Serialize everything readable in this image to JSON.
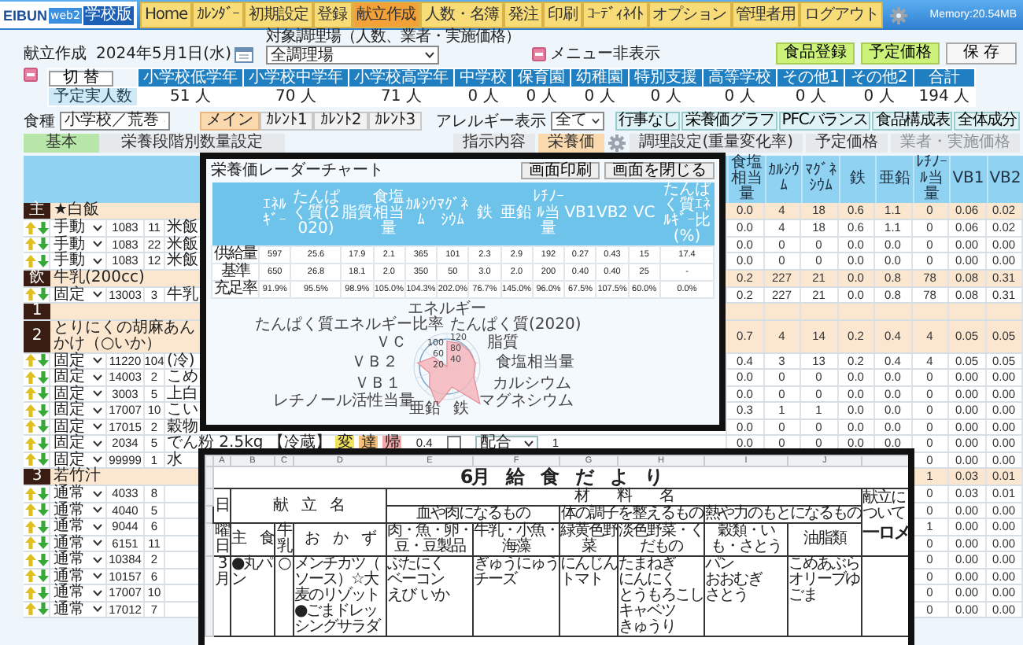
{
  "nav": {
    "logo": {
      "brand": "EIBUN",
      "product": "web2",
      "edition": "学校版"
    },
    "items": [
      {
        "label": "Home",
        "selected": false
      },
      {
        "label": "ｶﾚﾝﾀﾞｰ",
        "selected": false
      },
      {
        "label": "初期設定",
        "selected": false
      },
      {
        "label": "登録",
        "selected": false
      },
      {
        "label": "献立作成",
        "selected": true
      },
      {
        "label": "人数・名簿",
        "selected": false
      },
      {
        "label": "発注",
        "selected": false
      },
      {
        "label": "印刷",
        "selected": false
      },
      {
        "label": "ｺｰﾃﾞｨﾈｲﾄ",
        "selected": false
      },
      {
        "label": "オプション",
        "selected": false
      },
      {
        "label": "管理者用",
        "selected": false
      },
      {
        "label": "ログアウト",
        "selected": false
      }
    ],
    "memory": "Memory:20.54MB"
  },
  "header": {
    "title": "献立作成",
    "date": "2024年5月1日(水)",
    "kitchen_label": "対象調理場（人数、業者・実施価格）",
    "kitchen": "全調理場",
    "hide_menu": "メニュー非表示",
    "buttons": [
      {
        "label": "食品登録",
        "kind": "green"
      },
      {
        "label": "予定価格",
        "kind": "green"
      },
      {
        "label": "保 存",
        "kind": "plain"
      }
    ]
  },
  "headcount": {
    "switch_button": "切 替",
    "row_label": "予定実人数",
    "columns": [
      {
        "label": "小学校低学年",
        "count": "51 人"
      },
      {
        "label": "小学校中学年",
        "count": "70 人"
      },
      {
        "label": "小学校高学年",
        "count": "71 人"
      },
      {
        "label": "中学校",
        "count": "0 人"
      },
      {
        "label": "保育園",
        "count": "0 人"
      },
      {
        "label": "幼稚園",
        "count": "0 人"
      },
      {
        "label": "特別支援",
        "count": "0 人"
      },
      {
        "label": "高等学校",
        "count": "0 人"
      },
      {
        "label": "その他1",
        "count": "0 人"
      },
      {
        "label": "その他2",
        "count": "0 人"
      },
      {
        "label": "合計",
        "count": "194 人"
      }
    ]
  },
  "filters": {
    "meal_type_label": "食種",
    "meal_type": "小学校／荒巻",
    "menu_tabs": [
      {
        "label": "メイン",
        "selected": true
      },
      {
        "label": "ｶﾚﾝﾄ1",
        "selected": false
      },
      {
        "label": "ｶﾚﾝﾄ2",
        "selected": false
      },
      {
        "label": "ｶﾚﾝﾄ3",
        "selected": false
      }
    ],
    "allergy_label": "アレルギー表示",
    "allergy": "全て",
    "buttons": [
      "行事なし",
      "栄養価グラフ",
      "PFCバランス",
      "食品構成表",
      "全体成分"
    ]
  },
  "view_tabs": {
    "left": [
      {
        "label": "基本",
        "selected": true
      },
      {
        "label": "栄養段階別数量設定",
        "selected": false
      }
    ],
    "right": [
      {
        "label": "指示内容",
        "selected": false,
        "disabled": false,
        "has_gear": false
      },
      {
        "label": "栄養価",
        "selected": true,
        "disabled": false,
        "has_gear": false
      },
      {
        "label": "調理設定(重量変化率)",
        "selected": false,
        "disabled": false,
        "has_gear": true
      },
      {
        "label": "予定価格",
        "selected": false,
        "disabled": false,
        "has_gear": false
      },
      {
        "label": "業者・実施価格",
        "selected": false,
        "disabled": true,
        "has_gear": false
      }
    ]
  },
  "table": {
    "columns": [
      "食塩相当量",
      "ｶﾙｼｳﾑ",
      "ﾏｸﾞﾈｼｳﾑ",
      "鉄",
      "亜鉛",
      "ﾚﾁﾉｰﾙ当量",
      "VB1",
      "VB2"
    ],
    "rows": [
      {
        "kind": "section",
        "label": "主",
        "title": "★白飯",
        "values": [
          "0.0",
          "4",
          "18",
          "0.6",
          "1.1",
          "0",
          "0.06",
          "0.02"
        ]
      },
      {
        "kind": "item",
        "mode": "手動",
        "code": "1083",
        "qty": "11",
        "name": "米飯",
        "values": [
          "0.0",
          "4",
          "18",
          "0.6",
          "1.1",
          "0",
          "0.06",
          "0.02"
        ]
      },
      {
        "kind": "item",
        "mode": "手動",
        "code": "1083",
        "qty": "22",
        "name": "米飯",
        "values": [
          "0.0",
          "0",
          "0",
          "0.0",
          "0.0",
          "0",
          "0.00",
          "0.00"
        ]
      },
      {
        "kind": "item",
        "mode": "手動",
        "code": "1083",
        "qty": "12",
        "name": "米飯",
        "values": [
          "0.0",
          "0",
          "0",
          "0.0",
          "0.0",
          "0",
          "0.00",
          "0.00"
        ]
      },
      {
        "kind": "section",
        "label": "飲",
        "title": "牛乳(200cc)",
        "values": [
          "0.2",
          "227",
          "21",
          "0.0",
          "0.8",
          "78",
          "0.08",
          "0.31"
        ]
      },
      {
        "kind": "item",
        "mode": "固定",
        "code": "13003",
        "qty": "3",
        "name": "牛乳",
        "values": [
          "0.2",
          "227",
          "21",
          "0.0",
          "0.8",
          "78",
          "0.08",
          "0.31"
        ]
      },
      {
        "kind": "section",
        "label": "1"
      },
      {
        "kind": "section",
        "label": "2",
        "title": "とりにくの胡麻あんかけ（○いか）",
        "values": [
          "0.7",
          "4",
          "14",
          "0.2",
          "0.4",
          "4",
          "0.05",
          "0.05"
        ]
      },
      {
        "kind": "item",
        "mode": "固定",
        "code": "11220",
        "qty": "104",
        "name": "(冷)",
        "values": [
          "0.4",
          "3",
          "13",
          "0.2",
          "0.4",
          "4",
          "0.05",
          "0.05"
        ]
      },
      {
        "kind": "item",
        "mode": "固定",
        "code": "14003",
        "qty": "2",
        "name": "こめ",
        "values": [
          "0.0",
          "0",
          "0",
          "0.0",
          "0.0",
          "0",
          "0.00",
          "0.00"
        ]
      },
      {
        "kind": "item",
        "mode": "固定",
        "code": "3003",
        "qty": "5",
        "name": "上白",
        "values": [
          "0.0",
          "0",
          "0",
          "0.0",
          "0.0",
          "0",
          "0.00",
          "0.00"
        ]
      },
      {
        "kind": "item",
        "mode": "固定",
        "code": "17007",
        "qty": "10",
        "name": "こい",
        "values": [
          "0.3",
          "1",
          "1",
          "0.0",
          "0.0",
          "0",
          "0.00",
          "0.00"
        ]
      },
      {
        "kind": "item",
        "mode": "固定",
        "code": "17015",
        "qty": "2",
        "name": "穀物",
        "values": [
          "0.0",
          "0",
          "0",
          "0.0",
          "0.0",
          "0",
          "0.00",
          "0.00"
        ]
      },
      {
        "kind": "item",
        "mode": "固定",
        "code": "2034",
        "qty": "5",
        "name": "でん粉 2.5kg 【冷蔵】",
        "tags": [
          {
            "text": "変",
            "color": "#f2e35c"
          },
          {
            "text": "達",
            "color": "#f5c07a"
          },
          {
            "text": "帰",
            "color": "#f0a8a8"
          }
        ],
        "amount": "0.4",
        "checked": false,
        "unit": "配合",
        "count": "1",
        "values": [
          "0.0",
          "0",
          "0",
          "0.0",
          "0.0",
          "0",
          "0.00",
          "0.00"
        ]
      },
      {
        "kind": "item",
        "mode": "固定",
        "code": "99999",
        "qty": "1",
        "name": "水",
        "values": [
          "0",
          "0.00",
          "0.00"
        ]
      },
      {
        "kind": "section",
        "label": "3",
        "title": "若竹汁",
        "values": [
          "1",
          "0.03",
          "0.01"
        ]
      },
      {
        "kind": "item",
        "mode": "通常",
        "code": "4033",
        "qty": "8",
        "values": [
          "0",
          "0.03",
          "0.01"
        ]
      },
      {
        "kind": "item",
        "mode": "通常",
        "code": "4040",
        "qty": "5",
        "values": [
          "0",
          "0.00",
          "0.00"
        ]
      },
      {
        "kind": "item",
        "mode": "通常",
        "code": "9044",
        "qty": "6",
        "values": [
          "1",
          "0.00",
          "0.00"
        ]
      },
      {
        "kind": "item",
        "mode": "通常",
        "code": "6151",
        "qty": "11",
        "values": [
          "0",
          "0.00",
          "0.00"
        ]
      },
      {
        "kind": "item",
        "mode": "通常",
        "code": "10384",
        "qty": "2",
        "values": [
          "0",
          "0.00",
          "0.00"
        ]
      },
      {
        "kind": "item",
        "mode": "通常",
        "code": "10157",
        "qty": "6",
        "values": [
          "0",
          "0.00",
          "0.00"
        ]
      },
      {
        "kind": "item",
        "mode": "通常",
        "code": "17007",
        "qty": "10",
        "values": [
          "0",
          "0.00",
          "0.00"
        ]
      },
      {
        "kind": "item",
        "mode": "通常",
        "code": "17012",
        "qty": "7",
        "values": [
          "0",
          "0.00",
          "0.00"
        ]
      }
    ]
  },
  "radar_popup": {
    "title": "栄養価レーダーチャート",
    "buttons": [
      "画面印刷",
      "画面を閉じる"
    ],
    "columns": [
      "ｴﾈﾙｷﾞｰ",
      "たんぱく質(2020)",
      "脂質",
      "食塩相当量",
      "ｶﾙｼｳﾑ",
      "ﾏｸﾞﾈｼｳﾑ",
      "鉄",
      "亜鉛",
      "ﾚﾁﾉｰﾙ当量",
      "VB1",
      "VB2",
      "VC",
      "たんぱく質ｴﾈﾙｷﾞｰ比(%)"
    ],
    "rows": [
      {
        "label": "供給量",
        "values": [
          "597",
          "25.6",
          "17.9",
          "2.1",
          "365",
          "101",
          "2.3",
          "2.9",
          "192",
          "0.27",
          "0.43",
          "15",
          "17.4"
        ]
      },
      {
        "label": "基準",
        "values": [
          "650",
          "26.8",
          "18.1",
          "2.0",
          "350",
          "50",
          "3.0",
          "2.0",
          "200",
          "0.40",
          "0.40",
          "25",
          "-"
        ]
      },
      {
        "label": "充足率",
        "values": [
          "91.9%",
          "95.5%",
          "98.9%",
          "105.0%",
          "104.3%",
          "202.0%",
          "76.7%",
          "145.0%",
          "96.0%",
          "67.5%",
          "107.5%",
          "60.0%",
          "0.0%"
        ]
      }
    ],
    "radar": {
      "top_axis": "エネルギー",
      "left_axes": [
        "たんぱく質エネルギー比率",
        "ＶＣ",
        "ＶＢ２",
        "ＶＢ１",
        "レチノール活性当量"
      ],
      "right_axes": [
        "たんぱく質(2020)",
        "脂質",
        "食塩相当量",
        "カルシウム",
        "マグネシウム"
      ],
      "bottom_axes": [
        "亜鉛",
        "鉄"
      ],
      "ticks": [
        "120",
        "100",
        "80",
        "60",
        "40",
        "20"
      ]
    }
  },
  "newsletter": {
    "column_letters": [
      "A",
      "B",
      "C",
      "D",
      "E",
      "F",
      "G",
      "H",
      "I",
      "J"
    ],
    "title": "6月　給　食　だ　よ　り",
    "day_header": "日",
    "weekday_header": "曜日",
    "menu_header": "献　立　名",
    "materials_header": "材　　料　　名",
    "menu_columns": [
      "主　食",
      "牛乳",
      "お　か　ず"
    ],
    "groups": [
      {
        "label": "血や肉になるもの",
        "columns": [
          "肉・魚・卵・豆・豆製品",
          "牛乳・小魚・海藻"
        ]
      },
      {
        "label": "体の調子を整えるもの",
        "columns": [
          "緑黄色野菜",
          "淡色野菜・くだもの"
        ]
      },
      {
        "label": "熱や力のもとになるもの",
        "columns": [
          "穀類・いも・さとう",
          "油脂類"
        ]
      }
    ],
    "notes_label": "献立について",
    "memo_title": "一ロメ",
    "rows": [
      {
        "day": "3",
        "weekday": "月",
        "staple": "●丸パン",
        "milk": "○",
        "dishes": [
          "メンチカツ（ソース）☆大麦のリゾット",
          "●ごまドレッシングサラダ"
        ],
        "materials": [
          [
            "ぶたにく",
            "ベーコン",
            "えび",
            "いか"
          ],
          [
            "ぎゅうにゅう",
            "チーズ"
          ],
          [
            "にんじん",
            "トマト"
          ],
          [
            "たまねぎ",
            "にんにく",
            "とうもろこし",
            "キャベツ",
            "きゅうり"
          ],
          [
            "パン",
            "おおむぎ",
            "さとう"
          ],
          [
            "こめあぶら",
            "オリーブゆ",
            "ごま"
          ]
        ]
      }
    ]
  }
}
